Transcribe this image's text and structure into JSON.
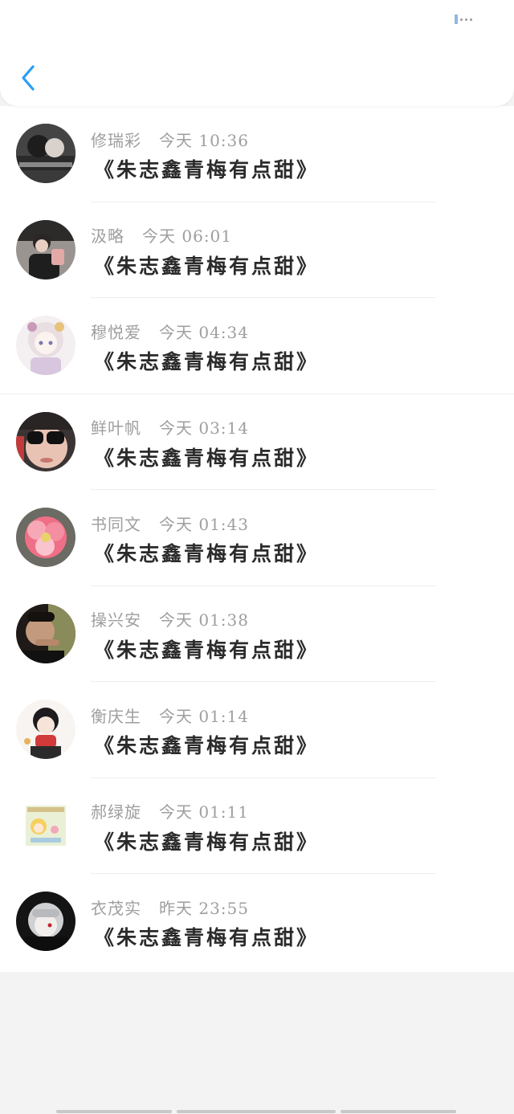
{
  "header": {
    "back_icon": "chevron-left-icon",
    "accent_color": "#2a9df4"
  },
  "messages": [
    {
      "name": "修瑞彩",
      "time": "今天 10:36",
      "text": "《朱志鑫青梅有点甜》",
      "avatar": "couple-photo-avatar"
    },
    {
      "name": "汲略",
      "time": "今天 06:01",
      "text": "《朱志鑫青梅有点甜》",
      "avatar": "boy-selfie-avatar"
    },
    {
      "name": "穆悦爱",
      "time": "今天 04:34",
      "text": "《朱志鑫青梅有点甜》",
      "avatar": "anime-girl-avatar"
    },
    {
      "name": "鲜叶帆",
      "time": "今天 03:14",
      "text": "《朱志鑫青梅有点甜》",
      "avatar": "sunglasses-avatar"
    },
    {
      "name": "书同文",
      "time": "今天 01:43",
      "text": "《朱志鑫青梅有点甜》",
      "avatar": "pink-flower-avatar"
    },
    {
      "name": "操兴安",
      "time": "今天 01:38",
      "text": "《朱志鑫青梅有点甜》",
      "avatar": "man-portrait-avatar"
    },
    {
      "name": "衡庆生",
      "time": "今天 01:14",
      "text": "《朱志鑫青梅有点甜》",
      "avatar": "cartoon-boy-avatar"
    },
    {
      "name": "郝绿旋",
      "time": "今天 01:11",
      "text": "《朱志鑫青梅有点甜》",
      "avatar": "cartoon-card-avatar"
    },
    {
      "name": "衣茂实",
      "time": "昨天 23:55",
      "text": "《朱志鑫青梅有点甜》",
      "avatar": "anime-silver-hair-avatar"
    }
  ]
}
